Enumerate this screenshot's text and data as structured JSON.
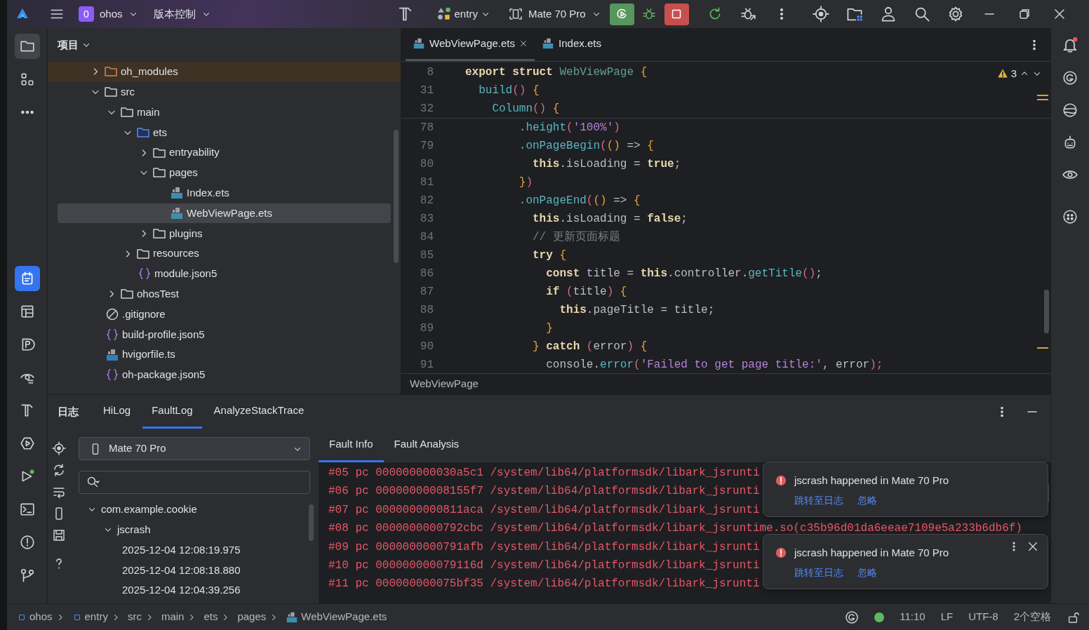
{
  "topbar": {
    "project": {
      "badge": "0",
      "name": "ohos"
    },
    "vcs": "版本控制",
    "module": "entry",
    "device": "Mate 70 Pro"
  },
  "project_panel": {
    "title": "项目",
    "tree": [
      {
        "label": "oh_modules",
        "kind": "excluded-folder",
        "expanded": false,
        "selected": false
      },
      {
        "label": "src",
        "kind": "folder",
        "expanded": true,
        "selected": false,
        "children": [
          {
            "label": "main",
            "kind": "folder",
            "expanded": true,
            "selected": false,
            "children": [
              {
                "label": "ets",
                "kind": "source-folder",
                "expanded": true,
                "selected": false,
                "children": [
                  {
                    "label": "entryability",
                    "kind": "folder",
                    "expanded": false,
                    "selected": false
                  },
                  {
                    "label": "pages",
                    "kind": "folder",
                    "expanded": true,
                    "selected": false,
                    "children": [
                      {
                        "label": "Index.ets",
                        "kind": "ets",
                        "selected": false
                      },
                      {
                        "label": "WebViewPage.ets",
                        "kind": "ets",
                        "selected": true
                      }
                    ]
                  },
                  {
                    "label": "plugins",
                    "kind": "folder",
                    "expanded": false,
                    "selected": false
                  }
                ]
              },
              {
                "label": "resources",
                "kind": "folder",
                "expanded": false,
                "selected": false
              },
              {
                "label": "module.json5",
                "kind": "json",
                "selected": false
              }
            ]
          },
          {
            "label": "ohosTest",
            "kind": "folder",
            "expanded": false,
            "selected": false
          }
        ]
      },
      {
        "label": ".gitignore",
        "kind": "ignore",
        "selected": false
      },
      {
        "label": "build-profile.json5",
        "kind": "json",
        "selected": false
      },
      {
        "label": "hvigorfile.ts",
        "kind": "ts",
        "selected": false
      },
      {
        "label": "oh-package.json5",
        "kind": "json",
        "selected": false
      }
    ]
  },
  "editor": {
    "tabs": [
      {
        "label": "WebViewPage.ets",
        "selected": true,
        "closable": true
      },
      {
        "label": "Index.ets",
        "selected": false,
        "closable": false
      }
    ],
    "warnings": "3",
    "sticky_lines": [
      {
        "number": "8",
        "tokens": [
          {
            "text": "export struct ",
            "kind": "keyword"
          },
          {
            "text": "WebViewPage ",
            "kind": "type"
          },
          {
            "text": "{",
            "kind": "brace"
          }
        ]
      },
      {
        "number": "31",
        "tokens": [
          {
            "text": "  build",
            "kind": "fn"
          },
          {
            "text": "() ",
            "kind": "paren"
          },
          {
            "text": "{",
            "kind": "brace"
          }
        ]
      },
      {
        "number": "32",
        "tokens": [
          {
            "text": "    Column",
            "kind": "fn"
          },
          {
            "text": "() ",
            "kind": "paren"
          },
          {
            "text": "{",
            "kind": "brace"
          }
        ]
      }
    ],
    "lines": [
      {
        "number": "78",
        "tokens": [
          {
            "text": "        .height",
            "kind": "fn"
          },
          {
            "text": "(",
            "kind": "paren"
          },
          {
            "text": "'100%'",
            "kind": "string"
          },
          {
            "text": ")",
            "kind": "paren"
          }
        ]
      },
      {
        "number": "79",
        "tokens": [
          {
            "text": "        .onPageBegin",
            "kind": "fn"
          },
          {
            "text": "(",
            "kind": "paren"
          },
          {
            "text": "()",
            "kind": "brace"
          },
          {
            "text": " => ",
            "kind": "plain"
          },
          {
            "text": "{",
            "kind": "brace"
          }
        ]
      },
      {
        "number": "80",
        "tokens": [
          {
            "text": "          this",
            "kind": "keyword"
          },
          {
            "text": ".isLoading = ",
            "kind": "plain"
          },
          {
            "text": "true",
            "kind": "keyword"
          },
          {
            "text": ";",
            "kind": "plain"
          }
        ]
      },
      {
        "number": "81",
        "tokens": [
          {
            "text": "        }",
            "kind": "brace"
          },
          {
            "text": ")",
            "kind": "paren"
          }
        ]
      },
      {
        "number": "82",
        "tokens": [
          {
            "text": "        .onPageEnd",
            "kind": "fn"
          },
          {
            "text": "(",
            "kind": "paren"
          },
          {
            "text": "()",
            "kind": "brace"
          },
          {
            "text": " => ",
            "kind": "plain"
          },
          {
            "text": "{",
            "kind": "brace"
          }
        ]
      },
      {
        "number": "83",
        "tokens": [
          {
            "text": "          this",
            "kind": "keyword"
          },
          {
            "text": ".isLoading = ",
            "kind": "plain"
          },
          {
            "text": "false",
            "kind": "keyword"
          },
          {
            "text": ";",
            "kind": "plain"
          }
        ]
      },
      {
        "number": "84",
        "tokens": [
          {
            "text": "          // 更新页面标题",
            "kind": "comment"
          }
        ]
      },
      {
        "number": "85",
        "tokens": [
          {
            "text": "          try ",
            "kind": "keyword"
          },
          {
            "text": "{",
            "kind": "brace"
          }
        ]
      },
      {
        "number": "86",
        "tokens": [
          {
            "text": "            const ",
            "kind": "keyword"
          },
          {
            "text": "title = ",
            "kind": "plain"
          },
          {
            "text": "this",
            "kind": "keyword"
          },
          {
            "text": ".controller.",
            "kind": "plain"
          },
          {
            "text": "getTitle",
            "kind": "fn"
          },
          {
            "text": "()",
            "kind": "paren"
          },
          {
            "text": ";",
            "kind": "plain"
          }
        ]
      },
      {
        "number": "87",
        "tokens": [
          {
            "text": "            if ",
            "kind": "keyword"
          },
          {
            "text": "(",
            "kind": "paren"
          },
          {
            "text": "title",
            "kind": "plain"
          },
          {
            "text": ") ",
            "kind": "paren"
          },
          {
            "text": "{",
            "kind": "brace"
          }
        ]
      },
      {
        "number": "88",
        "tokens": [
          {
            "text": "              this",
            "kind": "keyword"
          },
          {
            "text": ".pageTitle = title;",
            "kind": "plain"
          }
        ]
      },
      {
        "number": "89",
        "tokens": [
          {
            "text": "            }",
            "kind": "brace"
          }
        ]
      },
      {
        "number": "90",
        "tokens": [
          {
            "text": "          } ",
            "kind": "brace"
          },
          {
            "text": "catch ",
            "kind": "keyword"
          },
          {
            "text": "(",
            "kind": "paren"
          },
          {
            "text": "error",
            "kind": "plain"
          },
          {
            "text": ") ",
            "kind": "paren"
          },
          {
            "text": "{",
            "kind": "brace"
          }
        ]
      },
      {
        "number": "91",
        "tokens": [
          {
            "text": "            console.",
            "kind": "plain"
          },
          {
            "text": "error",
            "kind": "fn"
          },
          {
            "text": "(",
            "kind": "paren"
          },
          {
            "text": "'Failed to get page title:'",
            "kind": "string"
          },
          {
            "text": ", error",
            "kind": "plain"
          },
          {
            "text": ");",
            "kind": "paren"
          }
        ]
      }
    ],
    "breadcrumb": "WebViewPage"
  },
  "log_panel": {
    "title": "日志",
    "tabs": [
      {
        "label": "HiLog",
        "selected": false
      },
      {
        "label": "FaultLog",
        "selected": true
      },
      {
        "label": "AnalyzeStackTrace",
        "selected": false
      }
    ],
    "device": "Mate 70 Pro",
    "tree": [
      {
        "label": "com.example.cookie",
        "expanded": true,
        "children": [
          {
            "label": "jscrash",
            "expanded": true,
            "children": [
              {
                "label": "2025-12-04 12:08:19.975"
              },
              {
                "label": "2025-12-04 12:08:18.880"
              },
              {
                "label": "2025-12-04 12:04:39.256"
              }
            ]
          }
        ]
      }
    ],
    "subtabs": [
      {
        "label": "Fault Info",
        "selected": true
      },
      {
        "label": "Fault Analysis",
        "selected": false
      }
    ],
    "fault_lines": [
      "#05 pc 000000000030a5c1 /system/lib64/platformsdk/libark_jsrunti",
      "#06 pc 00000000008155f7 /system/lib64/platformsdk/libark_jsrunti",
      "#07 pc 0000000000811aca /system/lib64/platformsdk/libark_jsrunti",
      "#08 pc 0000000000792cbc /system/lib64/platformsdk/libark_jsruntime.so(c35b96d01da6eeae7109e5a233b6db6f)",
      "#09 pc 0000000000791afb /system/lib64/platformsdk/libark_jsrunti",
      "#10 pc 000000000079116d /system/lib64/platformsdk/libark_jsrunti",
      "#11 pc 000000000075bf35 /system/lib64/platformsdk/libark_jsrunti"
    ]
  },
  "notifications": [
    {
      "message": "jscrash happened in Mate 70 Pro",
      "actions": [
        "跳转至日志",
        "忽略"
      ],
      "show_controls": false
    },
    {
      "message": "jscrash happened in Mate 70 Pro",
      "actions": [
        "跳转至日志",
        "忽略"
      ],
      "show_controls": true
    }
  ],
  "status_bar": {
    "path": [
      {
        "label": "ohos",
        "kind": "module"
      },
      {
        "label": "entry",
        "kind": "module"
      },
      {
        "label": "src",
        "kind": "dir"
      },
      {
        "label": "main",
        "kind": "dir"
      },
      {
        "label": "ets",
        "kind": "dir"
      },
      {
        "label": "pages",
        "kind": "dir"
      },
      {
        "label": "WebViewPage.ets",
        "kind": "ets"
      }
    ],
    "position": "11:10",
    "line_ending": "LF",
    "encoding": "UTF-8",
    "indent": "2个空格"
  }
}
